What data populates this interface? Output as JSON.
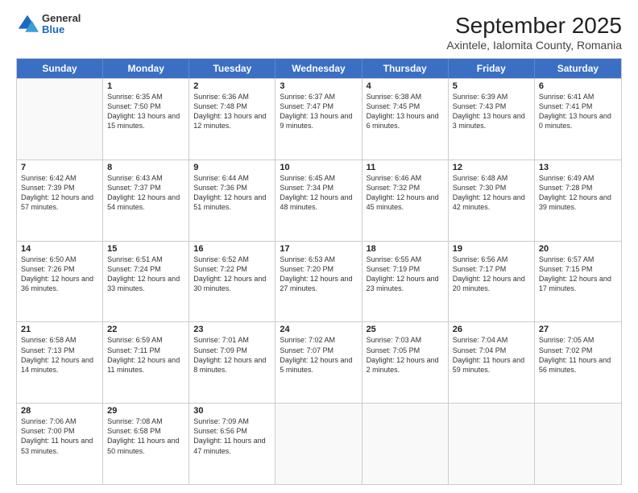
{
  "header": {
    "logo_general": "General",
    "logo_blue": "Blue",
    "title": "September 2025",
    "subtitle": "Axintele, Ialomita County, Romania"
  },
  "days_of_week": [
    "Sunday",
    "Monday",
    "Tuesday",
    "Wednesday",
    "Thursday",
    "Friday",
    "Saturday"
  ],
  "weeks": [
    [
      {
        "day": "",
        "sunrise": "",
        "sunset": "",
        "daylight": ""
      },
      {
        "day": "1",
        "sunrise": "Sunrise: 6:35 AM",
        "sunset": "Sunset: 7:50 PM",
        "daylight": "Daylight: 13 hours and 15 minutes."
      },
      {
        "day": "2",
        "sunrise": "Sunrise: 6:36 AM",
        "sunset": "Sunset: 7:48 PM",
        "daylight": "Daylight: 13 hours and 12 minutes."
      },
      {
        "day": "3",
        "sunrise": "Sunrise: 6:37 AM",
        "sunset": "Sunset: 7:47 PM",
        "daylight": "Daylight: 13 hours and 9 minutes."
      },
      {
        "day": "4",
        "sunrise": "Sunrise: 6:38 AM",
        "sunset": "Sunset: 7:45 PM",
        "daylight": "Daylight: 13 hours and 6 minutes."
      },
      {
        "day": "5",
        "sunrise": "Sunrise: 6:39 AM",
        "sunset": "Sunset: 7:43 PM",
        "daylight": "Daylight: 13 hours and 3 minutes."
      },
      {
        "day": "6",
        "sunrise": "Sunrise: 6:41 AM",
        "sunset": "Sunset: 7:41 PM",
        "daylight": "Daylight: 13 hours and 0 minutes."
      }
    ],
    [
      {
        "day": "7",
        "sunrise": "Sunrise: 6:42 AM",
        "sunset": "Sunset: 7:39 PM",
        "daylight": "Daylight: 12 hours and 57 minutes."
      },
      {
        "day": "8",
        "sunrise": "Sunrise: 6:43 AM",
        "sunset": "Sunset: 7:37 PM",
        "daylight": "Daylight: 12 hours and 54 minutes."
      },
      {
        "day": "9",
        "sunrise": "Sunrise: 6:44 AM",
        "sunset": "Sunset: 7:36 PM",
        "daylight": "Daylight: 12 hours and 51 minutes."
      },
      {
        "day": "10",
        "sunrise": "Sunrise: 6:45 AM",
        "sunset": "Sunset: 7:34 PM",
        "daylight": "Daylight: 12 hours and 48 minutes."
      },
      {
        "day": "11",
        "sunrise": "Sunrise: 6:46 AM",
        "sunset": "Sunset: 7:32 PM",
        "daylight": "Daylight: 12 hours and 45 minutes."
      },
      {
        "day": "12",
        "sunrise": "Sunrise: 6:48 AM",
        "sunset": "Sunset: 7:30 PM",
        "daylight": "Daylight: 12 hours and 42 minutes."
      },
      {
        "day": "13",
        "sunrise": "Sunrise: 6:49 AM",
        "sunset": "Sunset: 7:28 PM",
        "daylight": "Daylight: 12 hours and 39 minutes."
      }
    ],
    [
      {
        "day": "14",
        "sunrise": "Sunrise: 6:50 AM",
        "sunset": "Sunset: 7:26 PM",
        "daylight": "Daylight: 12 hours and 36 minutes."
      },
      {
        "day": "15",
        "sunrise": "Sunrise: 6:51 AM",
        "sunset": "Sunset: 7:24 PM",
        "daylight": "Daylight: 12 hours and 33 minutes."
      },
      {
        "day": "16",
        "sunrise": "Sunrise: 6:52 AM",
        "sunset": "Sunset: 7:22 PM",
        "daylight": "Daylight: 12 hours and 30 minutes."
      },
      {
        "day": "17",
        "sunrise": "Sunrise: 6:53 AM",
        "sunset": "Sunset: 7:20 PM",
        "daylight": "Daylight: 12 hours and 27 minutes."
      },
      {
        "day": "18",
        "sunrise": "Sunrise: 6:55 AM",
        "sunset": "Sunset: 7:19 PM",
        "daylight": "Daylight: 12 hours and 23 minutes."
      },
      {
        "day": "19",
        "sunrise": "Sunrise: 6:56 AM",
        "sunset": "Sunset: 7:17 PM",
        "daylight": "Daylight: 12 hours and 20 minutes."
      },
      {
        "day": "20",
        "sunrise": "Sunrise: 6:57 AM",
        "sunset": "Sunset: 7:15 PM",
        "daylight": "Daylight: 12 hours and 17 minutes."
      }
    ],
    [
      {
        "day": "21",
        "sunrise": "Sunrise: 6:58 AM",
        "sunset": "Sunset: 7:13 PM",
        "daylight": "Daylight: 12 hours and 14 minutes."
      },
      {
        "day": "22",
        "sunrise": "Sunrise: 6:59 AM",
        "sunset": "Sunset: 7:11 PM",
        "daylight": "Daylight: 12 hours and 11 minutes."
      },
      {
        "day": "23",
        "sunrise": "Sunrise: 7:01 AM",
        "sunset": "Sunset: 7:09 PM",
        "daylight": "Daylight: 12 hours and 8 minutes."
      },
      {
        "day": "24",
        "sunrise": "Sunrise: 7:02 AM",
        "sunset": "Sunset: 7:07 PM",
        "daylight": "Daylight: 12 hours and 5 minutes."
      },
      {
        "day": "25",
        "sunrise": "Sunrise: 7:03 AM",
        "sunset": "Sunset: 7:05 PM",
        "daylight": "Daylight: 12 hours and 2 minutes."
      },
      {
        "day": "26",
        "sunrise": "Sunrise: 7:04 AM",
        "sunset": "Sunset: 7:04 PM",
        "daylight": "Daylight: 11 hours and 59 minutes."
      },
      {
        "day": "27",
        "sunrise": "Sunrise: 7:05 AM",
        "sunset": "Sunset: 7:02 PM",
        "daylight": "Daylight: 11 hours and 56 minutes."
      }
    ],
    [
      {
        "day": "28",
        "sunrise": "Sunrise: 7:06 AM",
        "sunset": "Sunset: 7:00 PM",
        "daylight": "Daylight: 11 hours and 53 minutes."
      },
      {
        "day": "29",
        "sunrise": "Sunrise: 7:08 AM",
        "sunset": "Sunset: 6:58 PM",
        "daylight": "Daylight: 11 hours and 50 minutes."
      },
      {
        "day": "30",
        "sunrise": "Sunrise: 7:09 AM",
        "sunset": "Sunset: 6:56 PM",
        "daylight": "Daylight: 11 hours and 47 minutes."
      },
      {
        "day": "",
        "sunrise": "",
        "sunset": "",
        "daylight": ""
      },
      {
        "day": "",
        "sunrise": "",
        "sunset": "",
        "daylight": ""
      },
      {
        "day": "",
        "sunrise": "",
        "sunset": "",
        "daylight": ""
      },
      {
        "day": "",
        "sunrise": "",
        "sunset": "",
        "daylight": ""
      }
    ]
  ]
}
